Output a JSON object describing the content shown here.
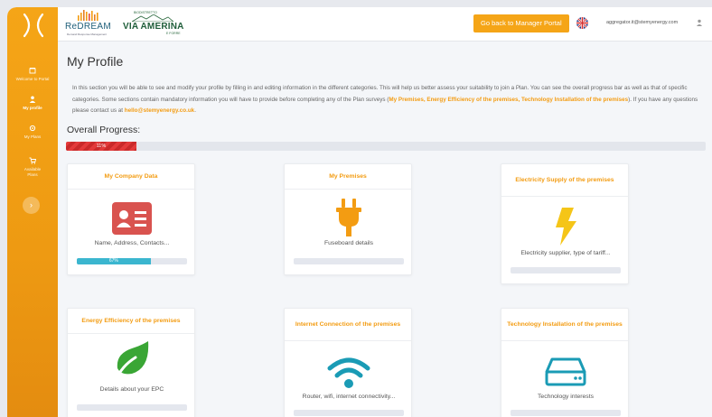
{
  "sidebar": {
    "items": [
      {
        "label": "Welcome to Portal",
        "icon": "home-icon"
      },
      {
        "label": "My profile",
        "icon": "user-icon"
      },
      {
        "label": "My Plans",
        "icon": "settings-icon"
      },
      {
        "label": "Available Plans",
        "icon": "cart-icon"
      }
    ],
    "collapse_glyph": "›"
  },
  "header": {
    "brand1": {
      "main": "ReDREAM",
      "sub": "Demand Response Management"
    },
    "brand2": {
      "top": "BIODISTRETTO",
      "main": "VIA AMERINA",
      "sub": "E FORRE"
    },
    "back_button": "Go back to Manager Portal",
    "user_email": "aggregator.it@stemyenergy.com"
  },
  "page": {
    "title": "My Profile",
    "intro_part1": "In this section you will be able to see and modify your profile by filling in and editing information in the different categories. This will help us better assess your suitability to join a Plan. You can see the overall progress bar as well as that of specific categories. Some sections contain mandatory information you will have to provide before completing any of the Plan surveys (",
    "intro_highlight": "My Premises, Energy Efficiency of the premises, Technology Installation of the premises",
    "intro_part2": "). If you have any questions please contact us at ",
    "intro_email": "hello@stemyenergy.co.uk",
    "intro_end": ".",
    "overall_label": "Overall Progress:",
    "overall_progress": 11,
    "overall_progress_label": "11%"
  },
  "cards": [
    {
      "title": "My Company Data",
      "icon": "id-card-icon",
      "description": "Name, Address, Contacts...",
      "progress": 67,
      "progress_label": "67%"
    },
    {
      "title": "My Premises",
      "icon": "plug-icon",
      "description": "Fuseboard details",
      "progress": 0,
      "progress_label": ""
    },
    {
      "title": "Electricity Supply of the premises",
      "icon": "lightning-icon",
      "description": "Electricity supplier, type of tariff...",
      "progress": 0,
      "progress_label": ""
    },
    {
      "title": "Energy Efficiency of the premises",
      "icon": "leaf-icon",
      "description": "Details about your EPC",
      "progress": 0,
      "progress_label": ""
    },
    {
      "title": "Internet Connection of the premises",
      "icon": "wifi-icon",
      "description": "Router, wifi, internet connectivity...",
      "progress": 0,
      "progress_label": ""
    },
    {
      "title": "Technology Installation of the premises",
      "icon": "server-icon",
      "description": "Technology interests",
      "progress": 0,
      "progress_label": ""
    }
  ],
  "colors": {
    "accent": "#f5a517",
    "heading": "#f39c12",
    "progress_overall": "#e43a3a",
    "progress_card": "#3bb6cf",
    "icon_red": "#d9534f",
    "icon_orange": "#f39c12",
    "icon_yellow": "#f5c518",
    "icon_green": "#3aa635",
    "icon_teal": "#1a9bb5"
  }
}
